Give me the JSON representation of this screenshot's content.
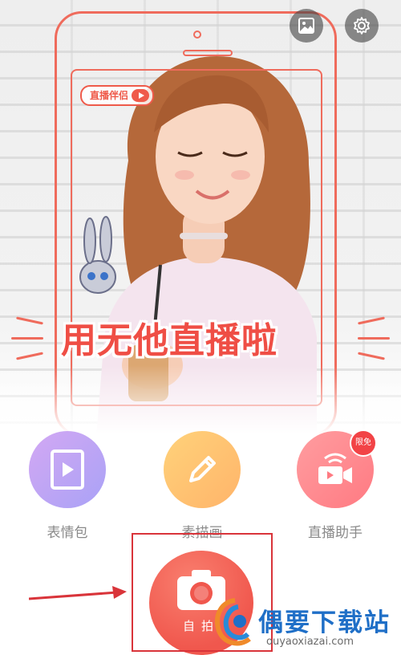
{
  "hero": {
    "badge_text": "直播伴侣",
    "slogan": "用无他直播啦"
  },
  "top_buttons": {
    "gallery_icon": "image-icon",
    "settings_icon": "gear-icon"
  },
  "features": [
    {
      "label": "表情包",
      "icon": "play-frame-icon",
      "color_from": "#d3a8f3",
      "color_to": "#a9a2f6"
    },
    {
      "label": "素描画",
      "icon": "pencil-icon",
      "color_from": "#ffd27a",
      "color_to": "#ffb46a"
    },
    {
      "label": "直播助手",
      "icon": "live-camera-icon",
      "color_from": "#ff9da0",
      "color_to": "#ff7a82",
      "badge": "限免"
    }
  ],
  "selfie": {
    "label": "自拍",
    "icon": "camera-icon"
  },
  "watermark": {
    "title": "偶要下载站",
    "url": "ouyaoxiazai.com"
  },
  "colors": {
    "accent": "#ef5a4a",
    "highlight_box": "#d9343a",
    "arrow": "#d9343a"
  }
}
